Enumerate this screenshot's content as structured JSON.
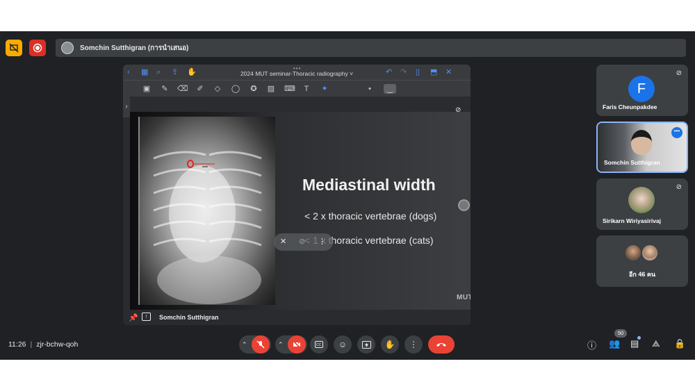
{
  "presenter_bar": {
    "name": "Somchin Sutthigran (การนำเสนอ)"
  },
  "shared_app": {
    "title": "2024 MUT seminar-Thoracic radiography ˅",
    "handle": "•••"
  },
  "slide": {
    "heading": "Mediastinal width",
    "bullets": [
      "< 2 x thoracic vertebrae (dogs)",
      "< 1 x thoracic vertebrae (cats)"
    ],
    "logo_text": "MUT"
  },
  "share_footer": {
    "presenter": "Somchin Sutthigran"
  },
  "participants": [
    {
      "name": "Faris Cheunpakdee",
      "initial": "F"
    },
    {
      "name": "Somchin Sutthigran"
    },
    {
      "name": "Sirikarn Wiriyasirivaj"
    },
    {
      "more_label": "อีก 46 คน"
    }
  ],
  "meeting": {
    "time": "11:26",
    "separator": "|",
    "code": "zjr-bchw-qoh"
  },
  "people_count": "50",
  "icons": {
    "top_left": [
      "screen-share-off-icon",
      "recording-icon"
    ],
    "controls": [
      "mic-off-icon",
      "camera-off-icon",
      "captions-icon",
      "emoji-icon",
      "present-icon",
      "raise-hand-icon",
      "more-options-icon",
      "end-call-icon"
    ],
    "right": [
      "info-icon",
      "people-icon",
      "chat-icon",
      "activities-icon",
      "host-controls-icon"
    ]
  },
  "colors": {
    "background": "#202124",
    "tile": "#3c4043",
    "danger": "#ea4335",
    "accent": "#1a73e8",
    "warning": "#f9ab00"
  }
}
